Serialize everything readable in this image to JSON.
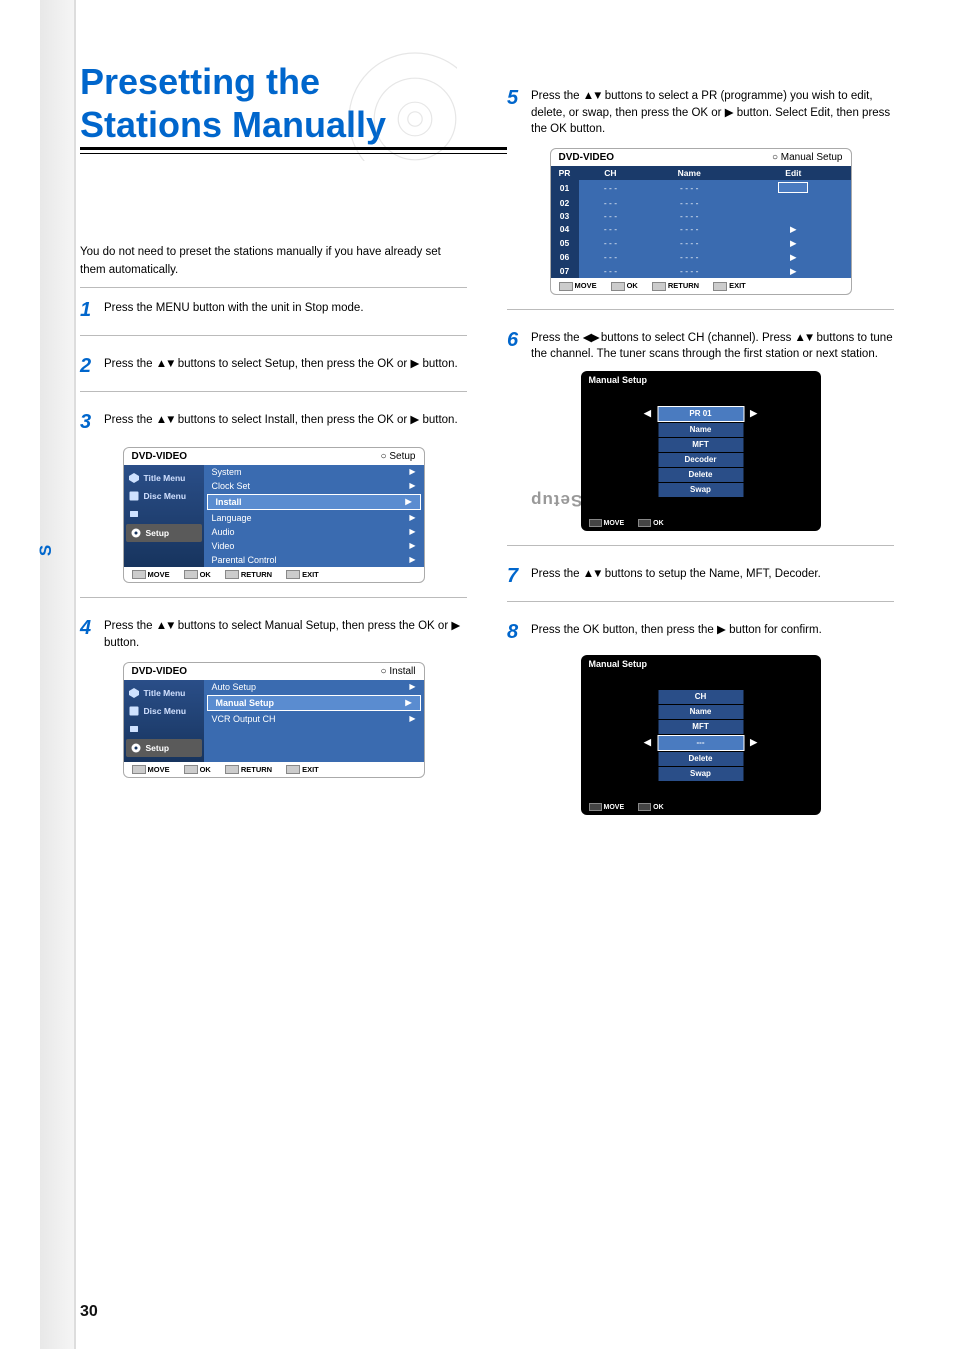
{
  "page_number": "30",
  "sidebar_label_pre": "S",
  "sidebar_label_rest": "ystem Setup",
  "title": "Presetting the Stations Manually",
  "intro": "You do not need to preset the stations manually if you have already set them automatically.",
  "steps": {
    "s1": {
      "num": "1",
      "text": "Press the MENU button with the unit in Stop mode."
    },
    "s2": {
      "num": "2",
      "text_a": "Press the ",
      "arrows": "▲▼",
      "text_b": " buttons to select Setup, then press the OK or ",
      "arrow_r": "▶",
      "text_c": " button."
    },
    "s3": {
      "num": "3",
      "text_a": "Press the ",
      "arrows": "▲▼",
      "text_b": " buttons to select Install, then press the OK or ",
      "arrow_r": "▶",
      "text_c": " button."
    },
    "s4": {
      "num": "4",
      "text_a": "Press the ",
      "arrows": "▲▼",
      "text_b": " buttons to select Manual Setup, then press the OK or ",
      "arrow_r": "▶",
      "text_c": " button."
    },
    "s5": {
      "num": "5",
      "text_a": "Press the ",
      "arrows": "▲▼",
      "text_b": " buttons to select a PR (programme) you wish to edit, delete, or swap, then press the OK or ",
      "arrow_r": "▶",
      "text_c": " button. Select Edit, then press the OK button."
    },
    "s6": {
      "num": "6",
      "text_a": "Press the ",
      "arrows": "◀ ▶",
      "text_b": " buttons to select CH (channel). Press ",
      "arrows2": "▲▼",
      "text_c": " buttons to tune the channel. The tuner scans through the first station or next station."
    },
    "s7": {
      "num": "7",
      "text_a": "Press the ",
      "arrows": "▲▼",
      "text_b": " buttons to setup the Name, MFT, Decoder."
    },
    "s8": {
      "num": "8",
      "text_a": "Press the OK button, then press the ",
      "arrow_r": "▶",
      "text_b": " button for confirm."
    }
  },
  "osd_common": {
    "brand": "DVD-VIDEO",
    "foot_move": "MOVE",
    "foot_ok": "OK",
    "foot_return": "RETURN",
    "foot_exit": "EXIT"
  },
  "osd_setup": {
    "crumb": "Setup",
    "left": [
      "Title Menu",
      "Disc Menu",
      "",
      "Setup"
    ],
    "rows": [
      "System",
      "Clock Set",
      "Install",
      "Language",
      "Audio",
      "Video",
      "Parental Control"
    ],
    "sel": 2
  },
  "osd_install": {
    "crumb": "Install",
    "left": [
      "Title Menu",
      "Disc Menu",
      "",
      "Setup"
    ],
    "rows": [
      "Auto Setup",
      "Manual Setup",
      "VCR Output CH"
    ],
    "sel": 1
  },
  "osd_manual": {
    "crumb": "Manual Setup",
    "headers": [
      "PR",
      "CH",
      "Name",
      "Edit"
    ],
    "rows": [
      {
        "pr": "01",
        "ch": "- - -",
        "name": "- - - -",
        "edit": "box"
      },
      {
        "pr": "02",
        "ch": "- - -",
        "name": "- - - -",
        "edit": ""
      },
      {
        "pr": "03",
        "ch": "- - -",
        "name": "- - - -",
        "edit": ""
      },
      {
        "pr": "04",
        "ch": "- - -",
        "name": "- - - -",
        "edit": "▶"
      },
      {
        "pr": "05",
        "ch": "- - -",
        "name": "- - - -",
        "edit": "▶"
      },
      {
        "pr": "06",
        "ch": "- - -",
        "name": "- - - -",
        "edit": "▶"
      },
      {
        "pr": "07",
        "ch": "- - -",
        "name": "- - - -",
        "edit": "▶"
      }
    ]
  },
  "osd_edit": {
    "title": "Manual Setup",
    "items": [
      "CH",
      "Name",
      "MFT",
      "Decoder",
      "Delete",
      "Swap"
    ],
    "sel": 0,
    "val": "PR 01"
  },
  "osd_edit2": {
    "title": "Manual Setup",
    "items": [
      "CH",
      "Name",
      "MFT",
      "Decoder",
      "Delete",
      "Swap"
    ],
    "sel": 3,
    "val": "---"
  }
}
